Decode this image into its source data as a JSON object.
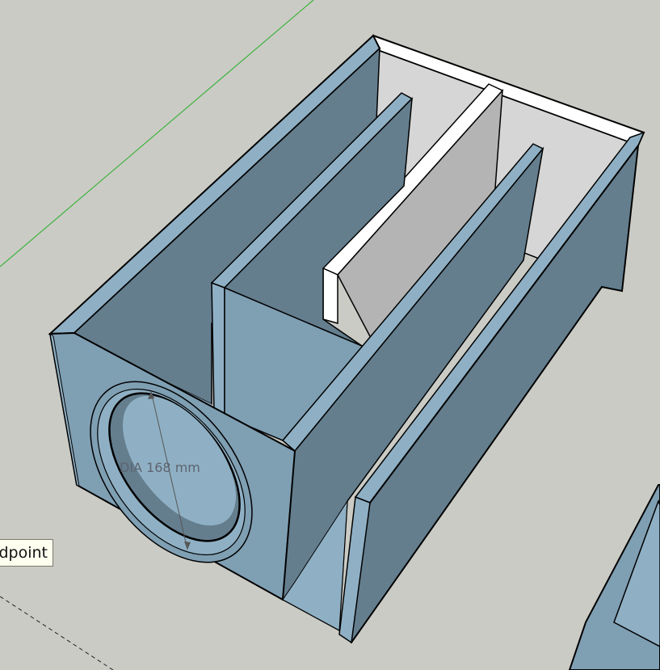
{
  "viewport": {
    "tooltip": "Endpoint",
    "dimension_label": "DIA 168 mm"
  },
  "colors": {
    "background": "#cbcbc6",
    "panel_face": "#7f9fb3",
    "panel_shadow": "#647e8e",
    "panel_light": "#8fb0c4",
    "inner_wall": "#d6d6d6",
    "inner_wall_dark": "#b4b4b4",
    "green_axis": "#3bb33b",
    "edge": "#000000"
  }
}
